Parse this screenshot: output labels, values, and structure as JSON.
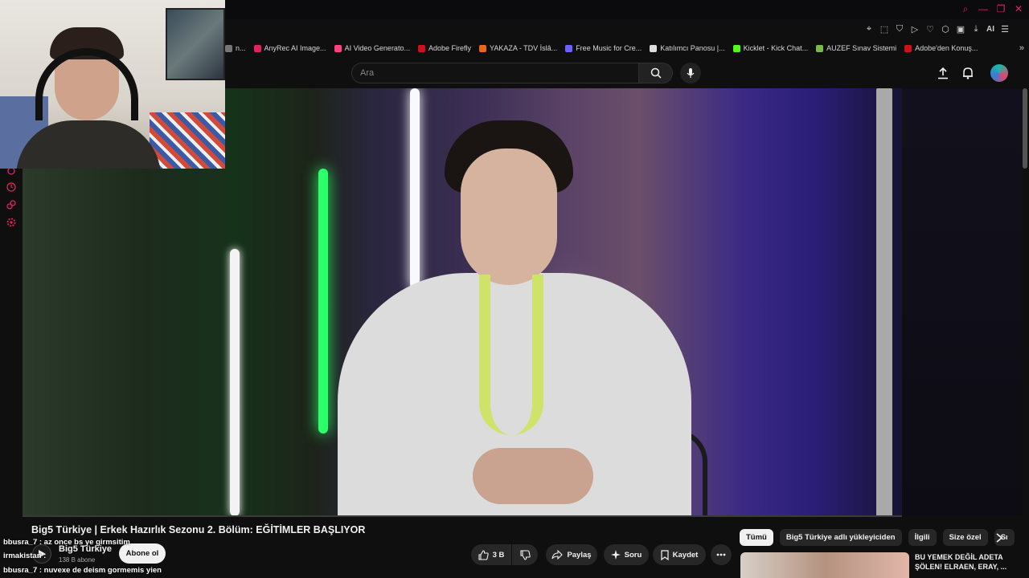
{
  "browser": {
    "window_controls": [
      "search",
      "minimize",
      "maximize",
      "close"
    ],
    "ext_ai_label": "AI",
    "bookmarks": [
      {
        "label": "n...",
        "color": "#777777"
      },
      {
        "label": "AnyRec AI Image...",
        "color": "#e0245e"
      },
      {
        "label": "AI Video Generato...",
        "color": "#ff4081"
      },
      {
        "label": "Adobe Firefly",
        "color": "#d0101a"
      },
      {
        "label": "YAKAZA - TDV İslâ...",
        "color": "#e8671f"
      },
      {
        "label": "Free Music for Cre...",
        "color": "#6b63ff"
      },
      {
        "label": "Katılımcı Panosu |...",
        "color": "#dddddd"
      },
      {
        "label": "Kicklet - Kick Chat...",
        "color": "#53fc18"
      },
      {
        "label": "AUZEF Sınav Sistemi",
        "color": "#7bb94e"
      },
      {
        "label": "Adobe'den Konuş...",
        "color": "#d0101a"
      }
    ]
  },
  "header": {
    "search_placeholder": "Ara"
  },
  "video": {
    "title": "Big5 Türkiye | Erkek Hazırlık Sezonu 2. Bölüm: EĞİTİMLER BAŞLIYOR"
  },
  "channel": {
    "name": "Big5 Türkiye",
    "subscribers": "138 B abone",
    "subscribe_label": "Abone ol"
  },
  "chat": [
    {
      "text": "bbusra_7 : az once bs ye girmsitim"
    },
    {
      "text": "irmakistan :"
    },
    {
      "text": "bbusra_7 : nuvexe de deism gormemis yien"
    }
  ],
  "actions": {
    "like_count": "3 B",
    "share_label": "Paylaş",
    "ask_label": "Soru",
    "save_label": "Kaydet"
  },
  "chips": [
    "Tümü",
    "Big5 Türkiye adlı yükleyiciden",
    "İlgili",
    "Size özel",
    "Sı"
  ],
  "recommendation": {
    "title": "BU YEMEK DEĞİL ADETA ŞÖLEN! ELRAEN, ERAY, ..."
  },
  "colors": {
    "accent": "#e0245e",
    "background": "#0f0f0f",
    "button_bg": "#272727"
  }
}
